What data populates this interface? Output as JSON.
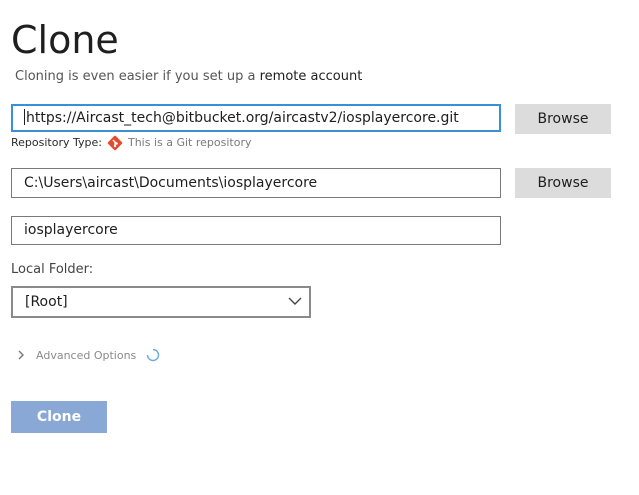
{
  "header": {
    "title": "Clone",
    "subtitle_text": "Cloning is even easier if you set up a ",
    "subtitle_link": "remote account"
  },
  "source": {
    "url_value": "https://Aircast_tech@bitbucket.org/aircastv2/iosplayercore.git",
    "browse_label": "Browse",
    "repo_type_label": "Repository Type:",
    "repo_type_value": "This is a Git repository"
  },
  "destination": {
    "path_value": "C:\\Users\\aircast\\Documents\\iosplayercore",
    "browse_label": "Browse"
  },
  "name": {
    "value": "iosplayercore"
  },
  "local_folder": {
    "label": "Local Folder:",
    "selected": "[Root]"
  },
  "advanced": {
    "label": "Advanced Options"
  },
  "actions": {
    "clone_label": "Clone"
  },
  "colors": {
    "focus_border": "#3a8fd8",
    "git_icon": "#e04e2f",
    "clone_button": "#89a8d6",
    "browse_button": "#dcdcdc"
  }
}
